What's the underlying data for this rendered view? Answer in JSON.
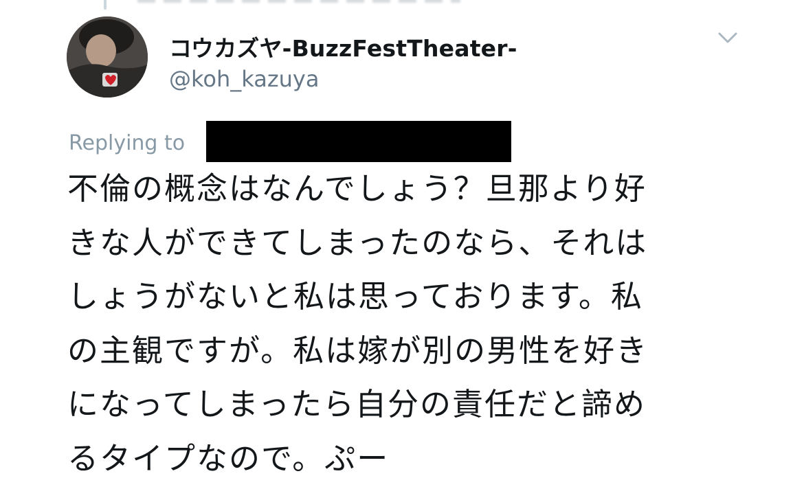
{
  "tweet": {
    "display_name": "コウカズヤ-BuzzFestTheater-",
    "handle": "@koh_kazuya",
    "replying_label": "Replying to",
    "body_lines": [
      "不倫の概念はなんでしょう？旦那より好",
      "きな人ができてしまったのなら、それは",
      "しょうがないと私は思っております。私",
      "の主観ですが。私は嫁が別の男性を好き",
      "になってしまったら自分の責任だと諦め",
      "るタイプなので。ぷー"
    ]
  },
  "icons": {
    "more": "chevron-down-icon",
    "avatar": "profile-photo"
  },
  "colors": {
    "text": "#14171a",
    "secondary": "#657786",
    "muted": "#8899a6",
    "redaction": "#000000"
  }
}
